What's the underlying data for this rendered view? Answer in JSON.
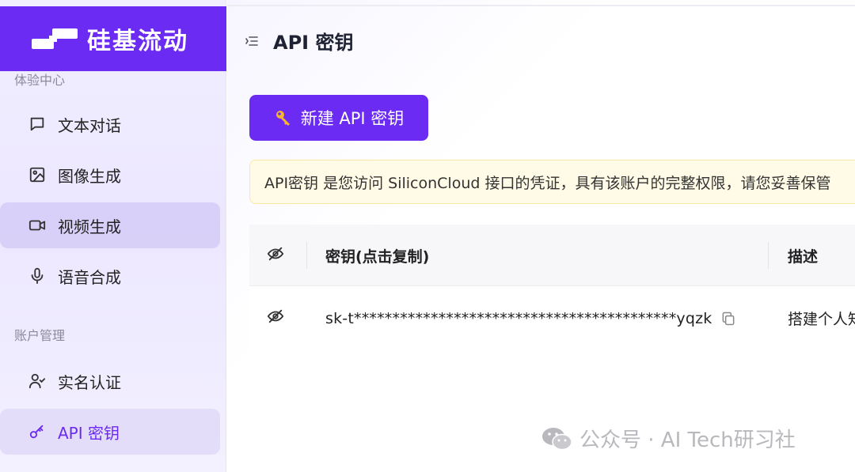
{
  "app": {
    "brand_name": "硅基流动",
    "accent_color": "#6c2bf2"
  },
  "sidebar": {
    "sections": [
      {
        "label": "体验中心",
        "items": [
          {
            "label": "文本对话",
            "icon": "message-square-icon"
          },
          {
            "label": "图像生成",
            "icon": "image-icon"
          },
          {
            "label": "视频生成",
            "icon": "video-camera-icon",
            "state": "hover"
          },
          {
            "label": "语音合成",
            "icon": "microphone-icon"
          }
        ]
      },
      {
        "label": "账户管理",
        "items": [
          {
            "label": "实名认证",
            "icon": "user-check-icon"
          },
          {
            "label": "API 密钥",
            "icon": "key-icon",
            "state": "active"
          }
        ]
      }
    ]
  },
  "header": {
    "title": "API 密钥",
    "menu_icon": "collapse-menu-icon"
  },
  "actions": {
    "new_key_label": "新建 API 密钥",
    "new_key_icon": "key-emoji-icon"
  },
  "notice": {
    "text": "API密钥 是您访问 SiliconCloud 接口的凭证，具有该账户的完整权限，请您妥善保管"
  },
  "table": {
    "columns": [
      "",
      "密钥(点击复制)",
      "描述"
    ],
    "rows": [
      {
        "key": "sk-t******************************************yqzk",
        "description": "搭建个人知识库"
      }
    ]
  },
  "watermark": {
    "text": "公众号 · AI Tech研习社"
  }
}
